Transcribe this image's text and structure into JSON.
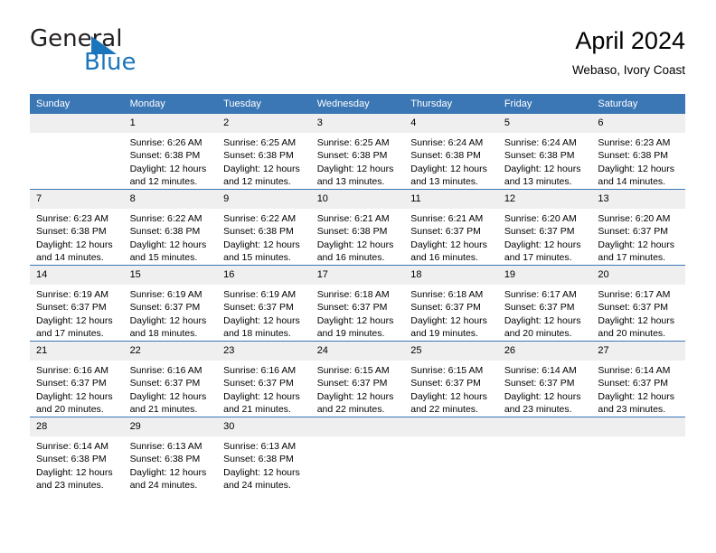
{
  "brand": {
    "name_part1": "General",
    "name_part2": "Blue",
    "accent_color": "#1b75bc"
  },
  "header": {
    "title": "April 2024",
    "subtitle": "Webaso, Ivory Coast"
  },
  "theme": {
    "header_blue": "#3b77b5",
    "daynum_gray": "#efefef"
  },
  "calendar": {
    "weekday_headers": [
      "Sunday",
      "Monday",
      "Tuesday",
      "Wednesday",
      "Thursday",
      "Friday",
      "Saturday"
    ],
    "weeks": [
      [
        {
          "day": "",
          "empty": true,
          "sunrise": "",
          "sunset": "",
          "daylight1": "",
          "daylight2": ""
        },
        {
          "day": "1",
          "empty": false,
          "sunrise": "Sunrise: 6:26 AM",
          "sunset": "Sunset: 6:38 PM",
          "daylight1": "Daylight: 12 hours",
          "daylight2": "and 12 minutes."
        },
        {
          "day": "2",
          "empty": false,
          "sunrise": "Sunrise: 6:25 AM",
          "sunset": "Sunset: 6:38 PM",
          "daylight1": "Daylight: 12 hours",
          "daylight2": "and 12 minutes."
        },
        {
          "day": "3",
          "empty": false,
          "sunrise": "Sunrise: 6:25 AM",
          "sunset": "Sunset: 6:38 PM",
          "daylight1": "Daylight: 12 hours",
          "daylight2": "and 13 minutes."
        },
        {
          "day": "4",
          "empty": false,
          "sunrise": "Sunrise: 6:24 AM",
          "sunset": "Sunset: 6:38 PM",
          "daylight1": "Daylight: 12 hours",
          "daylight2": "and 13 minutes."
        },
        {
          "day": "5",
          "empty": false,
          "sunrise": "Sunrise: 6:24 AM",
          "sunset": "Sunset: 6:38 PM",
          "daylight1": "Daylight: 12 hours",
          "daylight2": "and 13 minutes."
        },
        {
          "day": "6",
          "empty": false,
          "sunrise": "Sunrise: 6:23 AM",
          "sunset": "Sunset: 6:38 PM",
          "daylight1": "Daylight: 12 hours",
          "daylight2": "and 14 minutes."
        }
      ],
      [
        {
          "day": "7",
          "empty": false,
          "sunrise": "Sunrise: 6:23 AM",
          "sunset": "Sunset: 6:38 PM",
          "daylight1": "Daylight: 12 hours",
          "daylight2": "and 14 minutes."
        },
        {
          "day": "8",
          "empty": false,
          "sunrise": "Sunrise: 6:22 AM",
          "sunset": "Sunset: 6:38 PM",
          "daylight1": "Daylight: 12 hours",
          "daylight2": "and 15 minutes."
        },
        {
          "day": "9",
          "empty": false,
          "sunrise": "Sunrise: 6:22 AM",
          "sunset": "Sunset: 6:38 PM",
          "daylight1": "Daylight: 12 hours",
          "daylight2": "and 15 minutes."
        },
        {
          "day": "10",
          "empty": false,
          "sunrise": "Sunrise: 6:21 AM",
          "sunset": "Sunset: 6:38 PM",
          "daylight1": "Daylight: 12 hours",
          "daylight2": "and 16 minutes."
        },
        {
          "day": "11",
          "empty": false,
          "sunrise": "Sunrise: 6:21 AM",
          "sunset": "Sunset: 6:37 PM",
          "daylight1": "Daylight: 12 hours",
          "daylight2": "and 16 minutes."
        },
        {
          "day": "12",
          "empty": false,
          "sunrise": "Sunrise: 6:20 AM",
          "sunset": "Sunset: 6:37 PM",
          "daylight1": "Daylight: 12 hours",
          "daylight2": "and 17 minutes."
        },
        {
          "day": "13",
          "empty": false,
          "sunrise": "Sunrise: 6:20 AM",
          "sunset": "Sunset: 6:37 PM",
          "daylight1": "Daylight: 12 hours",
          "daylight2": "and 17 minutes."
        }
      ],
      [
        {
          "day": "14",
          "empty": false,
          "sunrise": "Sunrise: 6:19 AM",
          "sunset": "Sunset: 6:37 PM",
          "daylight1": "Daylight: 12 hours",
          "daylight2": "and 17 minutes."
        },
        {
          "day": "15",
          "empty": false,
          "sunrise": "Sunrise: 6:19 AM",
          "sunset": "Sunset: 6:37 PM",
          "daylight1": "Daylight: 12 hours",
          "daylight2": "and 18 minutes."
        },
        {
          "day": "16",
          "empty": false,
          "sunrise": "Sunrise: 6:19 AM",
          "sunset": "Sunset: 6:37 PM",
          "daylight1": "Daylight: 12 hours",
          "daylight2": "and 18 minutes."
        },
        {
          "day": "17",
          "empty": false,
          "sunrise": "Sunrise: 6:18 AM",
          "sunset": "Sunset: 6:37 PM",
          "daylight1": "Daylight: 12 hours",
          "daylight2": "and 19 minutes."
        },
        {
          "day": "18",
          "empty": false,
          "sunrise": "Sunrise: 6:18 AM",
          "sunset": "Sunset: 6:37 PM",
          "daylight1": "Daylight: 12 hours",
          "daylight2": "and 19 minutes."
        },
        {
          "day": "19",
          "empty": false,
          "sunrise": "Sunrise: 6:17 AM",
          "sunset": "Sunset: 6:37 PM",
          "daylight1": "Daylight: 12 hours",
          "daylight2": "and 20 minutes."
        },
        {
          "day": "20",
          "empty": false,
          "sunrise": "Sunrise: 6:17 AM",
          "sunset": "Sunset: 6:37 PM",
          "daylight1": "Daylight: 12 hours",
          "daylight2": "and 20 minutes."
        }
      ],
      [
        {
          "day": "21",
          "empty": false,
          "sunrise": "Sunrise: 6:16 AM",
          "sunset": "Sunset: 6:37 PM",
          "daylight1": "Daylight: 12 hours",
          "daylight2": "and 20 minutes."
        },
        {
          "day": "22",
          "empty": false,
          "sunrise": "Sunrise: 6:16 AM",
          "sunset": "Sunset: 6:37 PM",
          "daylight1": "Daylight: 12 hours",
          "daylight2": "and 21 minutes."
        },
        {
          "day": "23",
          "empty": false,
          "sunrise": "Sunrise: 6:16 AM",
          "sunset": "Sunset: 6:37 PM",
          "daylight1": "Daylight: 12 hours",
          "daylight2": "and 21 minutes."
        },
        {
          "day": "24",
          "empty": false,
          "sunrise": "Sunrise: 6:15 AM",
          "sunset": "Sunset: 6:37 PM",
          "daylight1": "Daylight: 12 hours",
          "daylight2": "and 22 minutes."
        },
        {
          "day": "25",
          "empty": false,
          "sunrise": "Sunrise: 6:15 AM",
          "sunset": "Sunset: 6:37 PM",
          "daylight1": "Daylight: 12 hours",
          "daylight2": "and 22 minutes."
        },
        {
          "day": "26",
          "empty": false,
          "sunrise": "Sunrise: 6:14 AM",
          "sunset": "Sunset: 6:37 PM",
          "daylight1": "Daylight: 12 hours",
          "daylight2": "and 23 minutes."
        },
        {
          "day": "27",
          "empty": false,
          "sunrise": "Sunrise: 6:14 AM",
          "sunset": "Sunset: 6:37 PM",
          "daylight1": "Daylight: 12 hours",
          "daylight2": "and 23 minutes."
        }
      ],
      [
        {
          "day": "28",
          "empty": false,
          "sunrise": "Sunrise: 6:14 AM",
          "sunset": "Sunset: 6:38 PM",
          "daylight1": "Daylight: 12 hours",
          "daylight2": "and 23 minutes."
        },
        {
          "day": "29",
          "empty": false,
          "sunrise": "Sunrise: 6:13 AM",
          "sunset": "Sunset: 6:38 PM",
          "daylight1": "Daylight: 12 hours",
          "daylight2": "and 24 minutes."
        },
        {
          "day": "30",
          "empty": false,
          "sunrise": "Sunrise: 6:13 AM",
          "sunset": "Sunset: 6:38 PM",
          "daylight1": "Daylight: 12 hours",
          "daylight2": "and 24 minutes."
        },
        {
          "day": "",
          "empty": true,
          "sunrise": "",
          "sunset": "",
          "daylight1": "",
          "daylight2": ""
        },
        {
          "day": "",
          "empty": true,
          "sunrise": "",
          "sunset": "",
          "daylight1": "",
          "daylight2": ""
        },
        {
          "day": "",
          "empty": true,
          "sunrise": "",
          "sunset": "",
          "daylight1": "",
          "daylight2": ""
        },
        {
          "day": "",
          "empty": true,
          "sunrise": "",
          "sunset": "",
          "daylight1": "",
          "daylight2": ""
        }
      ]
    ]
  }
}
